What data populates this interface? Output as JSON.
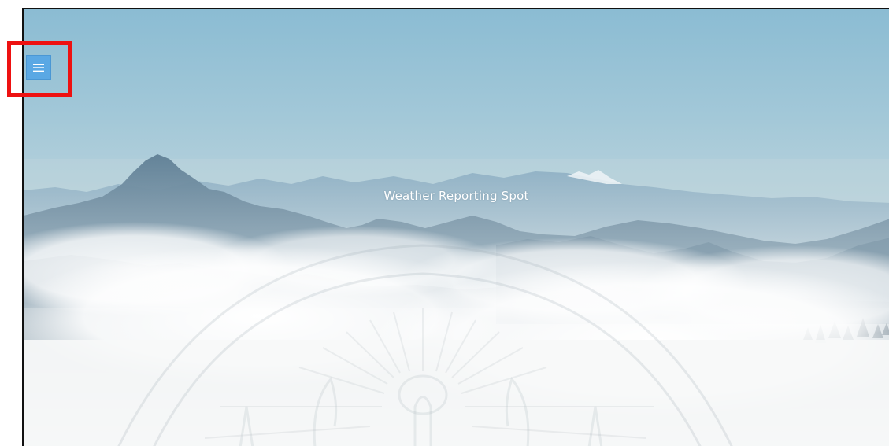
{
  "page": {
    "title": "Weather Reporting Spot"
  },
  "nav": {
    "menu_icon": "hamburger-menu-icon"
  },
  "colors": {
    "menu_button": "#5aa8e4",
    "highlight_box": "#ee1111",
    "title_text": "#ffffff"
  }
}
